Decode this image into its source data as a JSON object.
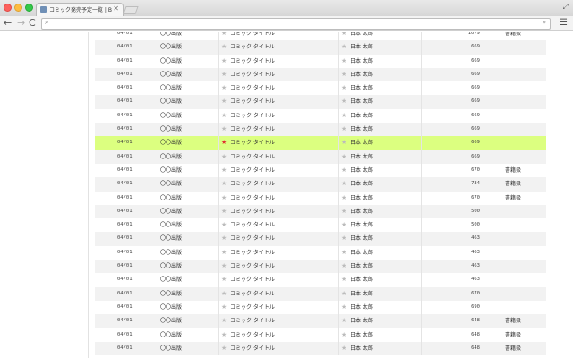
{
  "browser": {
    "tab_title": "コミック発売予定一覧 | Boo",
    "tab_close": "✕",
    "back": "←",
    "forward": "→",
    "reload": "C",
    "address_value": "",
    "menu": "☰",
    "omnibox_ext": "»"
  },
  "table": {
    "rows": [
      {
        "date": "04/01",
        "publisher": "〇〇出版",
        "title": "コミック タイトル",
        "author": "日本 太郎",
        "price": "1079",
        "note": "書籍扱",
        "star_red": false,
        "highlight": false
      },
      {
        "date": "04/01",
        "publisher": "〇〇出版",
        "title": "コミック タイトル",
        "author": "日本 太郎",
        "price": "669",
        "note": "",
        "star_red": false,
        "highlight": false
      },
      {
        "date": "04/01",
        "publisher": "〇〇出版",
        "title": "コミック タイトル",
        "author": "日本 太郎",
        "price": "669",
        "note": "",
        "star_red": false,
        "highlight": false
      },
      {
        "date": "04/01",
        "publisher": "〇〇出版",
        "title": "コミック タイトル",
        "author": "日本 太郎",
        "price": "669",
        "note": "",
        "star_red": false,
        "highlight": false
      },
      {
        "date": "04/01",
        "publisher": "〇〇出版",
        "title": "コミック タイトル",
        "author": "日本 太郎",
        "price": "669",
        "note": "",
        "star_red": false,
        "highlight": false
      },
      {
        "date": "04/01",
        "publisher": "〇〇出版",
        "title": "コミック タイトル",
        "author": "日本 太郎",
        "price": "669",
        "note": "",
        "star_red": false,
        "highlight": false
      },
      {
        "date": "04/01",
        "publisher": "〇〇出版",
        "title": "コミック タイトル",
        "author": "日本 太郎",
        "price": "669",
        "note": "",
        "star_red": false,
        "highlight": false
      },
      {
        "date": "04/01",
        "publisher": "〇〇出版",
        "title": "コミック タイトル",
        "author": "日本 太郎",
        "price": "669",
        "note": "",
        "star_red": false,
        "highlight": false
      },
      {
        "date": "04/01",
        "publisher": "〇〇出版",
        "title": "コミック タイトル",
        "author": "日本 太郎",
        "price": "669",
        "note": "",
        "star_red": true,
        "highlight": true
      },
      {
        "date": "04/01",
        "publisher": "〇〇出版",
        "title": "コミック タイトル",
        "author": "日本 太郎",
        "price": "669",
        "note": "",
        "star_red": false,
        "highlight": false
      },
      {
        "date": "04/01",
        "publisher": "〇〇出版",
        "title": "コミック タイトル",
        "author": "日本 太郎",
        "price": "670",
        "note": "書籍扱",
        "star_red": false,
        "highlight": false
      },
      {
        "date": "04/01",
        "publisher": "〇〇出版",
        "title": "コミック タイトル",
        "author": "日本 太郎",
        "price": "734",
        "note": "書籍扱",
        "star_red": false,
        "highlight": false
      },
      {
        "date": "04/01",
        "publisher": "〇〇出版",
        "title": "コミック タイトル",
        "author": "日本 太郎",
        "price": "670",
        "note": "書籍扱",
        "star_red": false,
        "highlight": false
      },
      {
        "date": "04/01",
        "publisher": "〇〇出版",
        "title": "コミック タイトル",
        "author": "日本 太郎",
        "price": "500",
        "note": "",
        "star_red": false,
        "highlight": false
      },
      {
        "date": "04/01",
        "publisher": "〇〇出版",
        "title": "コミック タイトル",
        "author": "日本 太郎",
        "price": "500",
        "note": "",
        "star_red": false,
        "highlight": false
      },
      {
        "date": "04/01",
        "publisher": "〇〇出版",
        "title": "コミック タイトル",
        "author": "日本 太郎",
        "price": "463",
        "note": "",
        "star_red": false,
        "highlight": false
      },
      {
        "date": "04/01",
        "publisher": "〇〇出版",
        "title": "コミック タイトル",
        "author": "日本 太郎",
        "price": "463",
        "note": "",
        "star_red": false,
        "highlight": false
      },
      {
        "date": "04/01",
        "publisher": "〇〇出版",
        "title": "コミック タイトル",
        "author": "日本 太郎",
        "price": "463",
        "note": "",
        "star_red": false,
        "highlight": false
      },
      {
        "date": "04/01",
        "publisher": "〇〇出版",
        "title": "コミック タイトル",
        "author": "日本 太郎",
        "price": "463",
        "note": "",
        "star_red": false,
        "highlight": false
      },
      {
        "date": "04/01",
        "publisher": "〇〇出版",
        "title": "コミック タイトル",
        "author": "日本 太郎",
        "price": "670",
        "note": "",
        "star_red": false,
        "highlight": false
      },
      {
        "date": "04/01",
        "publisher": "〇〇出版",
        "title": "コミック タイトル",
        "author": "日本 太郎",
        "price": "690",
        "note": "",
        "star_red": false,
        "highlight": false
      },
      {
        "date": "04/01",
        "publisher": "〇〇出版",
        "title": "コミック タイトル",
        "author": "日本 太郎",
        "price": "648",
        "note": "書籍扱",
        "star_red": false,
        "highlight": false
      },
      {
        "date": "04/01",
        "publisher": "〇〇出版",
        "title": "コミック タイトル",
        "author": "日本 太郎",
        "price": "648",
        "note": "書籍扱",
        "star_red": false,
        "highlight": false
      },
      {
        "date": "04/01",
        "publisher": "〇〇出版",
        "title": "コミック タイトル",
        "author": "日本 太郎",
        "price": "648",
        "note": "書籍扱",
        "star_red": false,
        "highlight": false
      }
    ]
  },
  "icons": {
    "star": "★",
    "search": "🔍"
  },
  "colors": {
    "highlight_row": "#dcff80",
    "favorite_star": "#e03030"
  }
}
